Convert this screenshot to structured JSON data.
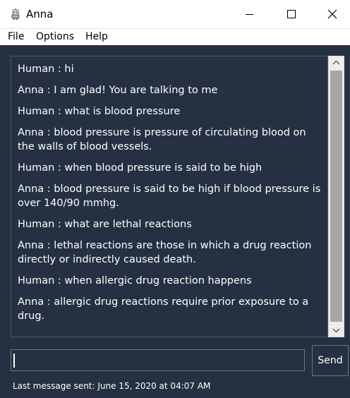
{
  "window": {
    "title": "Anna",
    "app_icon": "robot-icon"
  },
  "menu": {
    "items": [
      "File",
      "Options",
      "Help"
    ]
  },
  "chat": {
    "messages": [
      "Human : hi",
      "Anna : I am glad! You are talking to me",
      "Human : what is blood pressure",
      "Anna : blood pressure is pressure of circulating blood on the walls of blood vessels.",
      "Human : when blood pressure is said to be high",
      "Anna : blood pressure is said to be high if blood pressure is over 140/90 mmhg.",
      "Human : what are lethal reactions",
      "Anna : lethal reactions are those in which a drug reaction directly or indirectly caused death.",
      "Human : when allergic drug reaction happens",
      "Anna : allergic drug reactions require prior exposure to a drug."
    ]
  },
  "input": {
    "value": ""
  },
  "send": {
    "label": "Send"
  },
  "status": {
    "text": "Last message sent: June 15, 2020 at 04:07 AM"
  },
  "colors": {
    "background": "#253142",
    "text": "#ffffff",
    "scrollbar_thumb": "#a6a6a6"
  }
}
